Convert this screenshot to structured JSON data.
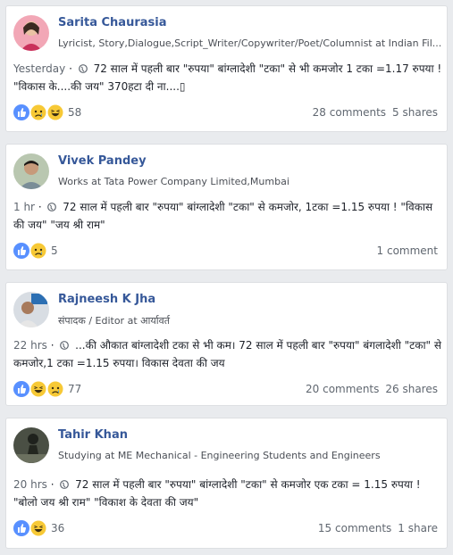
{
  "posts": [
    {
      "name": "Sarita Chaurasia",
      "headline": "Lyricist, Story,Dialogue,Script_Writer/Copywriter/Poet/Columnist at Indian Fil...",
      "time": "Yesterday",
      "text": "72 साल में पहली बार \"रुपया\" बांग्लादेशी \"टका\" से भी कमजोर 1 टका =1.17 रुपया ! \"विकास के....की जय\" 370हटा दी ना....▯",
      "reactions": [
        "like",
        "sad",
        "haha"
      ],
      "reaction_count": "58",
      "comments": "28 comments",
      "shares": "5 shares"
    },
    {
      "name": "Vivek Pandey",
      "headline": "Works at Tata Power Company Limited,Mumbai",
      "time": "1 hr",
      "text": "72 साल में पहली बार \"रुपया\" बांग्लादेशी \"टका\" से कमजोर, 1टका =1.15 रुपया ! \"विकास की जय\" \"जय श्री राम\"",
      "reactions": [
        "like",
        "sad"
      ],
      "reaction_count": "5",
      "comments": "1 comment",
      "shares": ""
    },
    {
      "name": "Rajneesh K Jha",
      "headline": "संपादक / Editor at आर्यावर्त",
      "time": "22 hrs",
      "text": "...की औकात बांग्लादेशी टका से भी कम। 72 साल में पहली बार \"रुपया\" बंगलादेशी \"टका\" से कमजोर,1 टका =1.15 रुपया। विकास देवता की जय",
      "reactions": [
        "like",
        "haha",
        "sad"
      ],
      "reaction_count": "77",
      "comments": "20 comments",
      "shares": "26 shares"
    },
    {
      "name": "Tahir Khan",
      "headline": "Studying at ME Mechanical - Engineering Students and Engineers",
      "time": "20 hrs",
      "text": "72 साल में पहली बार \"रुपया\" बांग्लादेशी \"टका\" से कमजोर एक टका = 1.15 रुपया ! \"बोलो जय श्री राम\" \"विकाश के देवता की जय\"",
      "reactions": [
        "like",
        "haha"
      ],
      "reaction_count": "36",
      "comments": "15 comments",
      "shares": "1 share"
    }
  ],
  "colors": {
    "name": "#365899",
    "like": "#5890ff",
    "emoji": "#f7c936",
    "background": "#e9ebee"
  }
}
